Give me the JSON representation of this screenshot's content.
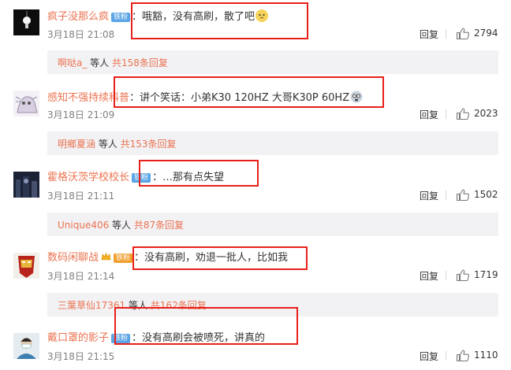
{
  "comments": [
    {
      "user": "疯子没那么疯",
      "badge": "铁粉",
      "text": "：哦豁，没有高刷，散了吧",
      "time": "3月18日 21:08",
      "reply": "回复",
      "likes": "2794",
      "thread": {
        "users": "啊哒a_",
        "mid": " 等人 ",
        "count": "共158条回复"
      }
    },
    {
      "user": "感知不强持续科普",
      "badge": "",
      "text": "：讲个笑话：小弟K30 120HZ  大哥K30P 60HZ",
      "time": "3月18日 21:09",
      "reply": "回复",
      "likes": "2023",
      "thread": {
        "users": "明鄉夏涵",
        "mid": " 等人 ",
        "count": "共153条回复"
      }
    },
    {
      "user": "霍格沃茨学校校长",
      "badge": "铁粉",
      "text": "：…那有点失望",
      "time": "3月18日 21:11",
      "reply": "回复",
      "likes": "1502",
      "thread": {
        "users": "Unique406",
        "mid": " 等人 ",
        "count": "共87条回复"
      }
    },
    {
      "user": "数码闲聊战",
      "badge": "铁粉",
      "text": "：没有高刷，劝退一批人，比如我",
      "time": "3月18日 21:14",
      "reply": "回复",
      "likes": "1719",
      "thread": {
        "users": "三葉草仙17361",
        "mid": " 等人 ",
        "count": "共162条回复"
      }
    },
    {
      "user": "戴口罩的影子",
      "badge": "铁粉",
      "text": "：没有高刷会被喷死，讲真的",
      "time": "3月18日 21:15",
      "reply": "回复",
      "likes": "1110"
    }
  ],
  "colors": {
    "username": "#eb7350",
    "badge": "#5ba4e5",
    "highlight_box": "#e8201a",
    "thread_bg": "#f2f2f5"
  },
  "icons": [
    "thumbs-up-icon",
    "crown-icon",
    "emoji-face-icon"
  ]
}
